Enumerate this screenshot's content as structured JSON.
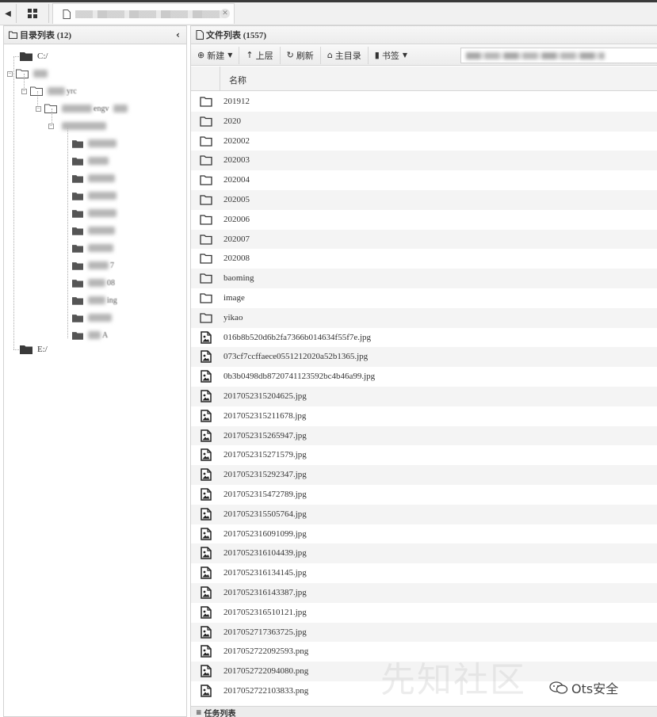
{
  "left_panel": {
    "title": "目录列表 (12)",
    "collapse_icon": "chevron-left-icon",
    "drives": [
      "C:/",
      "E:/"
    ],
    "visible_partial_texts": [
      "yrc",
      "engv",
      "7",
      "08",
      "ing",
      "A"
    ]
  },
  "right_panel": {
    "title": "文件列表 (1557)",
    "toolbar": {
      "new_label": "新建",
      "up_label": "上层",
      "refresh_label": "刷新",
      "home_label": "主目录",
      "bookmark_label": "书签"
    },
    "column_name": "名称",
    "files": [
      {
        "name": "201912",
        "type": "folder"
      },
      {
        "name": "2020",
        "type": "folder"
      },
      {
        "name": "202002",
        "type": "folder"
      },
      {
        "name": "202003",
        "type": "folder"
      },
      {
        "name": "202004",
        "type": "folder"
      },
      {
        "name": "202005",
        "type": "folder"
      },
      {
        "name": "202006",
        "type": "folder"
      },
      {
        "name": "202007",
        "type": "folder"
      },
      {
        "name": "202008",
        "type": "folder"
      },
      {
        "name": "baoming",
        "type": "folder"
      },
      {
        "name": "image",
        "type": "folder"
      },
      {
        "name": "yikao",
        "type": "folder"
      },
      {
        "name": "016b8b520d6b2fa7366b014634f55f7e.jpg",
        "type": "image"
      },
      {
        "name": "073cf7ccffaece0551212020a52b1365.jpg",
        "type": "image"
      },
      {
        "name": "0b3b0498db8720741123592bc4b46a99.jpg",
        "type": "image"
      },
      {
        "name": "2017052315204625.jpg",
        "type": "image"
      },
      {
        "name": "2017052315211678.jpg",
        "type": "image"
      },
      {
        "name": "2017052315265947.jpg",
        "type": "image"
      },
      {
        "name": "2017052315271579.jpg",
        "type": "image"
      },
      {
        "name": "2017052315292347.jpg",
        "type": "image"
      },
      {
        "name": "2017052315472789.jpg",
        "type": "image"
      },
      {
        "name": "2017052315505764.jpg",
        "type": "image"
      },
      {
        "name": "2017052316091099.jpg",
        "type": "image"
      },
      {
        "name": "2017052316104439.jpg",
        "type": "image"
      },
      {
        "name": "2017052316134145.jpg",
        "type": "image"
      },
      {
        "name": "2017052316143387.jpg",
        "type": "image"
      },
      {
        "name": "2017052316510121.jpg",
        "type": "image"
      },
      {
        "name": "2017052717363725.jpg",
        "type": "image"
      },
      {
        "name": "2017052722092593.png",
        "type": "image"
      },
      {
        "name": "2017052722094080.png",
        "type": "image"
      },
      {
        "name": "2017052722103833.png",
        "type": "image"
      }
    ],
    "status_label": "任务列表"
  },
  "watermark": {
    "text": "Ots安全",
    "ghost_text": "先知社区"
  },
  "colors": {
    "panel_header": "#ececec",
    "row_alt": "#f4f4f4",
    "border": "#d2d2d2",
    "topbar_line": "#3a3a3a"
  }
}
